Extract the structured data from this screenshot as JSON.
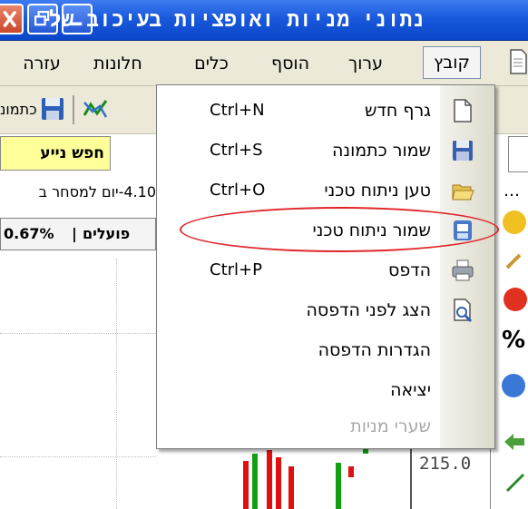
{
  "window": {
    "title": "נתוני מניות ואופציות בעיכוב של",
    "controls": {
      "close": "close-button",
      "restore": "restore-button",
      "minimize": "minimize-button"
    }
  },
  "menubar": {
    "items": [
      "קובץ",
      "ערוך",
      "הוסף",
      "כלים",
      "חלונות",
      "עזרה"
    ],
    "active": "קובץ"
  },
  "toolbar": {
    "label": "כתמונ"
  },
  "info": {
    "search": "חפש נייע",
    "trade_row": "4.10-יום למסחר ב",
    "stock": {
      "percent": "0.67%",
      "separator": "|",
      "name": "פועלים"
    }
  },
  "chart": {
    "axis_value": "215.0"
  },
  "file_menu": {
    "items": [
      {
        "label": "גרף חדש",
        "shortcut": "Ctrl+N",
        "icon": "new-document-icon",
        "enabled": true
      },
      {
        "label": "שמור כתמונה",
        "shortcut": "Ctrl+S",
        "icon": "floppy-disk-icon",
        "enabled": true
      },
      {
        "label": "טען ניתוח טכני",
        "shortcut": "Ctrl+O",
        "icon": "open-folder-icon",
        "enabled": true
      },
      {
        "label": "שמור ניתוח טכני",
        "shortcut": "",
        "icon": "save-analysis-icon",
        "enabled": true
      },
      {
        "label": "הדפס",
        "shortcut": "Ctrl+P",
        "icon": "printer-icon",
        "enabled": true
      },
      {
        "label": "הצג לפני הדפסה",
        "shortcut": "",
        "icon": "print-preview-icon",
        "enabled": true
      },
      {
        "label": "הגדרות הדפסה",
        "shortcut": "",
        "icon": "",
        "enabled": true
      },
      {
        "label": "יציאה",
        "shortcut": "",
        "icon": "",
        "enabled": true
      },
      {
        "label": "שערי מניות",
        "shortcut": "",
        "icon": "",
        "enabled": false
      }
    ]
  },
  "colors": {
    "titlebar": "#1a59dc",
    "menubar": "#ece9d8",
    "annotation": "#e0262a",
    "search_bg": "#ffff99",
    "candle_red": "#e01010",
    "candle_green": "#12a012"
  }
}
